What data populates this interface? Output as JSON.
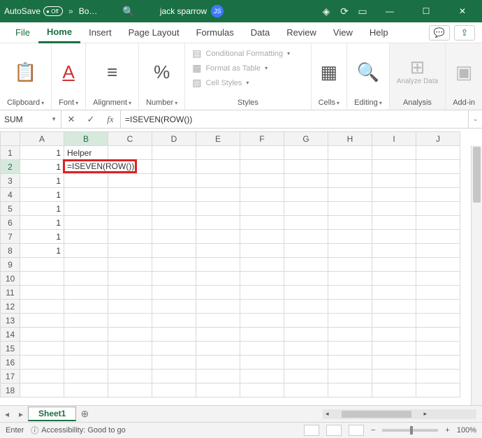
{
  "titlebar": {
    "autosave_label": "AutoSave",
    "autosave_state": "Off",
    "more": "»",
    "doc_name": "Bo…",
    "user_name": "jack sparrow",
    "user_initials": "JS"
  },
  "tabs": {
    "file": "File",
    "home": "Home",
    "insert": "Insert",
    "page_layout": "Page Layout",
    "formulas": "Formulas",
    "data": "Data",
    "review": "Review",
    "view": "View",
    "help": "Help"
  },
  "ribbon": {
    "clipboard": "Clipboard",
    "font": "Font",
    "alignment": "Alignment",
    "number": "Number",
    "cond_fmt": "Conditional Formatting",
    "fmt_table": "Format as Table",
    "cell_styles": "Cell Styles",
    "styles": "Styles",
    "cells": "Cells",
    "editing": "Editing",
    "analyze": "Analyze Data",
    "analysis": "Analysis",
    "addin": "Add-in"
  },
  "formula_bar": {
    "namebox": "SUM",
    "formula": "=ISEVEN(ROW())"
  },
  "columns": [
    "A",
    "B",
    "C",
    "D",
    "E",
    "F",
    "G",
    "H",
    "I",
    "J"
  ],
  "rows": [
    "1",
    "2",
    "3",
    "4",
    "5",
    "6",
    "7",
    "8",
    "9",
    "10",
    "11",
    "12",
    "13",
    "14",
    "15",
    "16",
    "17",
    "18"
  ],
  "cells": {
    "A1": "1",
    "A2": "1",
    "A3": "1",
    "A4": "1",
    "A5": "1",
    "A6": "1",
    "A7": "1",
    "A8": "1",
    "B1": "Helper",
    "B2_editing": "=ISEVEN(ROW())"
  },
  "sheet": {
    "name": "Sheet1"
  },
  "status": {
    "mode": "Enter",
    "accessibility": "Accessibility: Good to go",
    "zoom": "100%"
  },
  "chart_data": null
}
